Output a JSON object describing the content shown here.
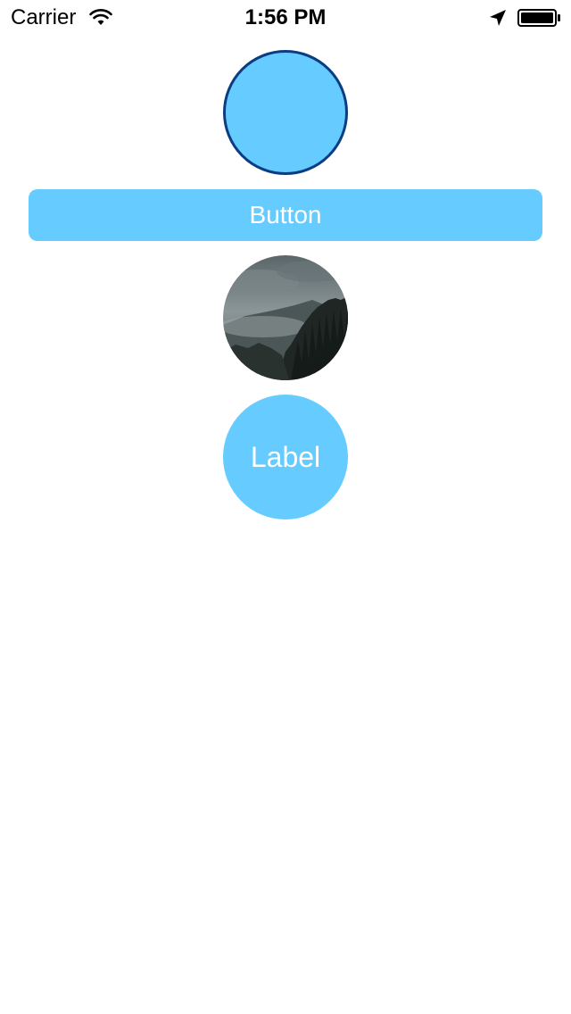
{
  "status_bar": {
    "carrier": "Carrier",
    "time": "1:56 PM",
    "icons": [
      "wifi-icon",
      "location-arrow-icon",
      "battery-icon"
    ]
  },
  "main": {
    "button_label": "Button",
    "label_text": "Label",
    "photo_subject": "forest-mountain-photo"
  },
  "colors": {
    "accent": "#66ccff",
    "circle_border": "#0b3d82",
    "text_on_accent": "#ffffff"
  }
}
